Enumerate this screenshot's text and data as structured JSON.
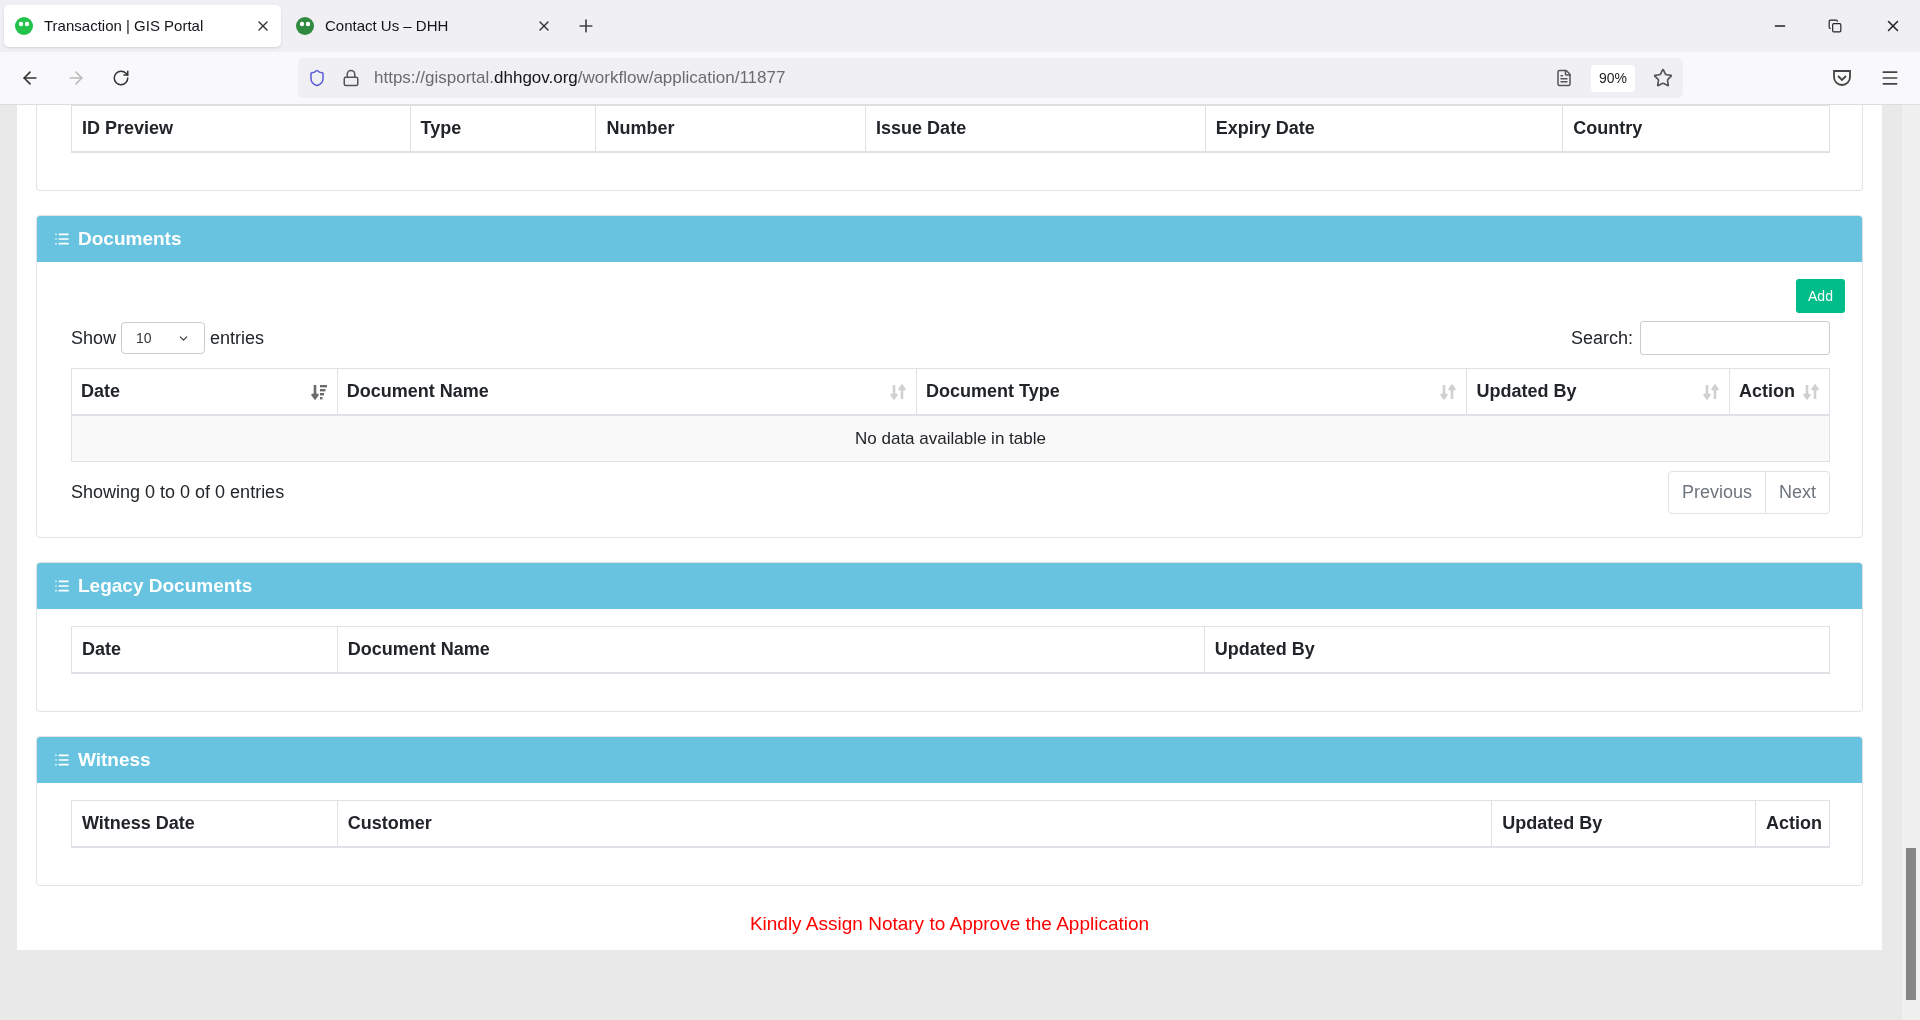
{
  "browser": {
    "tabs": [
      {
        "title": "Transaction | GIS Portal",
        "selected": true
      },
      {
        "title": "Contact Us – DHH",
        "selected": false
      }
    ],
    "nav": {
      "back_disabled": false,
      "forward_disabled": true
    },
    "url": {
      "scheme_host": "https://gisportal.",
      "domain": "dhhgov.org",
      "path": "/workflow/application/11877"
    },
    "zoom": "90%"
  },
  "id_table": {
    "columns": [
      "ID Preview",
      "Type",
      "Number",
      "Issue Date",
      "Expiry Date",
      "Country"
    ]
  },
  "documents": {
    "title": "Documents",
    "add_button": "Add",
    "show_label": "Show",
    "page_size": "10",
    "entries_label": "entries",
    "search_label": "Search:",
    "columns": [
      {
        "label": "Date",
        "sorted": true
      },
      {
        "label": "Document Name",
        "sorted": false
      },
      {
        "label": "Document Type",
        "sorted": false
      },
      {
        "label": "Updated By",
        "sorted": false
      },
      {
        "label": "Action",
        "sorted": false
      }
    ],
    "empty_message": "No data available in table",
    "info": "Showing 0 to 0 of 0 entries",
    "pagination": [
      {
        "label": "Previous",
        "disabled": true
      },
      {
        "label": "Next",
        "disabled": true
      }
    ]
  },
  "legacy_documents": {
    "title": "Legacy Documents",
    "columns": [
      "Date",
      "Document Name",
      "Updated By"
    ]
  },
  "witness": {
    "title": "Witness",
    "columns": [
      "Witness Date",
      "Customer",
      "Updated By",
      "Action"
    ]
  },
  "notice": "Kindly Assign Notary to Approve the Application"
}
